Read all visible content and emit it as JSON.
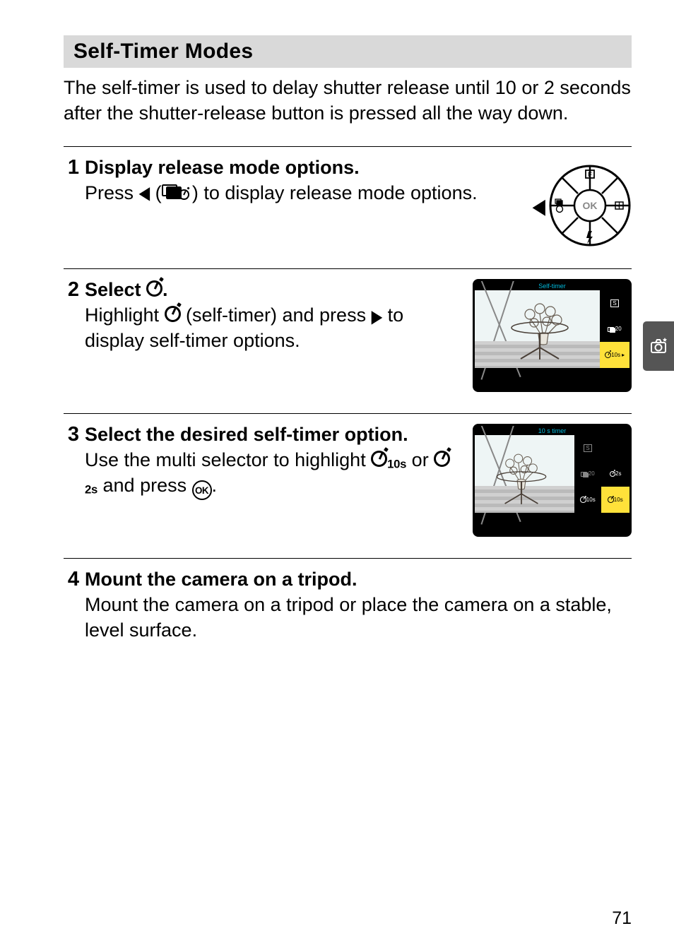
{
  "section_title": "Self-Timer Modes",
  "intro": "The self-timer is used to delay shutter release until 10 or 2 seconds after the shutter-release button is pressed all the way down.",
  "steps": [
    {
      "num": "1",
      "title": "Display release mode options.",
      "text_before": "Press ",
      "text_mid": " (",
      "text_after": ") to display release mode options."
    },
    {
      "num": "2",
      "title_before": "Select ",
      "title_after": ".",
      "text_before": "Highlight ",
      "text_mid": " (self-timer) and press ",
      "text_after": " to display self-timer options.",
      "screenshot_title": "Self-timer",
      "opts": {
        "a": "S",
        "b": "20",
        "c": "10s"
      }
    },
    {
      "num": "3",
      "title": "Select the desired self-timer option.",
      "text_before": "Use the multi selector to highlight ",
      "text_mid": " or ",
      "text_mid2": " and press ",
      "text_after": ".",
      "screenshot_title": "10 s timer",
      "opts": {
        "a": "S",
        "b": "20",
        "c": "10s",
        "d": "2s",
        "e": "10s"
      }
    },
    {
      "num": "4",
      "title": "Mount the camera on a tripod.",
      "text": "Mount the camera on a tripod or place the camera on a stable, level surface."
    }
  ],
  "page_number": "71"
}
